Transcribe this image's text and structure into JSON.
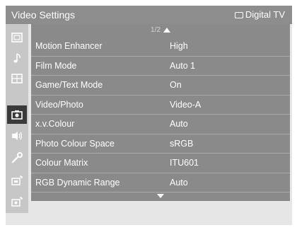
{
  "header": {
    "title": "Video Settings",
    "source": "Digital TV",
    "source_icon": "tv-icon"
  },
  "sidebar": {
    "items": [
      {
        "icon": "picture-icon",
        "active": false
      },
      {
        "icon": "music-note-icon",
        "active": false
      },
      {
        "icon": "grid-icon",
        "active": false
      },
      {
        "icon": "camera-icon",
        "active": true
      },
      {
        "icon": "speaker-icon",
        "active": false
      },
      {
        "icon": "wrench-icon",
        "active": false
      },
      {
        "icon": "antenna-screen-icon",
        "active": false
      },
      {
        "icon": "antenna-screen-2-icon",
        "active": false
      }
    ]
  },
  "page_indicator": "1/2",
  "settings": [
    {
      "label": "Motion Enhancer",
      "value": "High"
    },
    {
      "label": "Film Mode",
      "value": "Auto 1"
    },
    {
      "label": "Game/Text Mode",
      "value": "On"
    },
    {
      "label": "Video/Photo",
      "value": "Video-A"
    },
    {
      "label": "x.v.Colour",
      "value": "Auto"
    },
    {
      "label": "Photo Colour Space",
      "value": "sRGB"
    },
    {
      "label": "Colour Matrix",
      "value": "ITU601"
    },
    {
      "label": "RGB Dynamic Range",
      "value": "Auto"
    }
  ]
}
